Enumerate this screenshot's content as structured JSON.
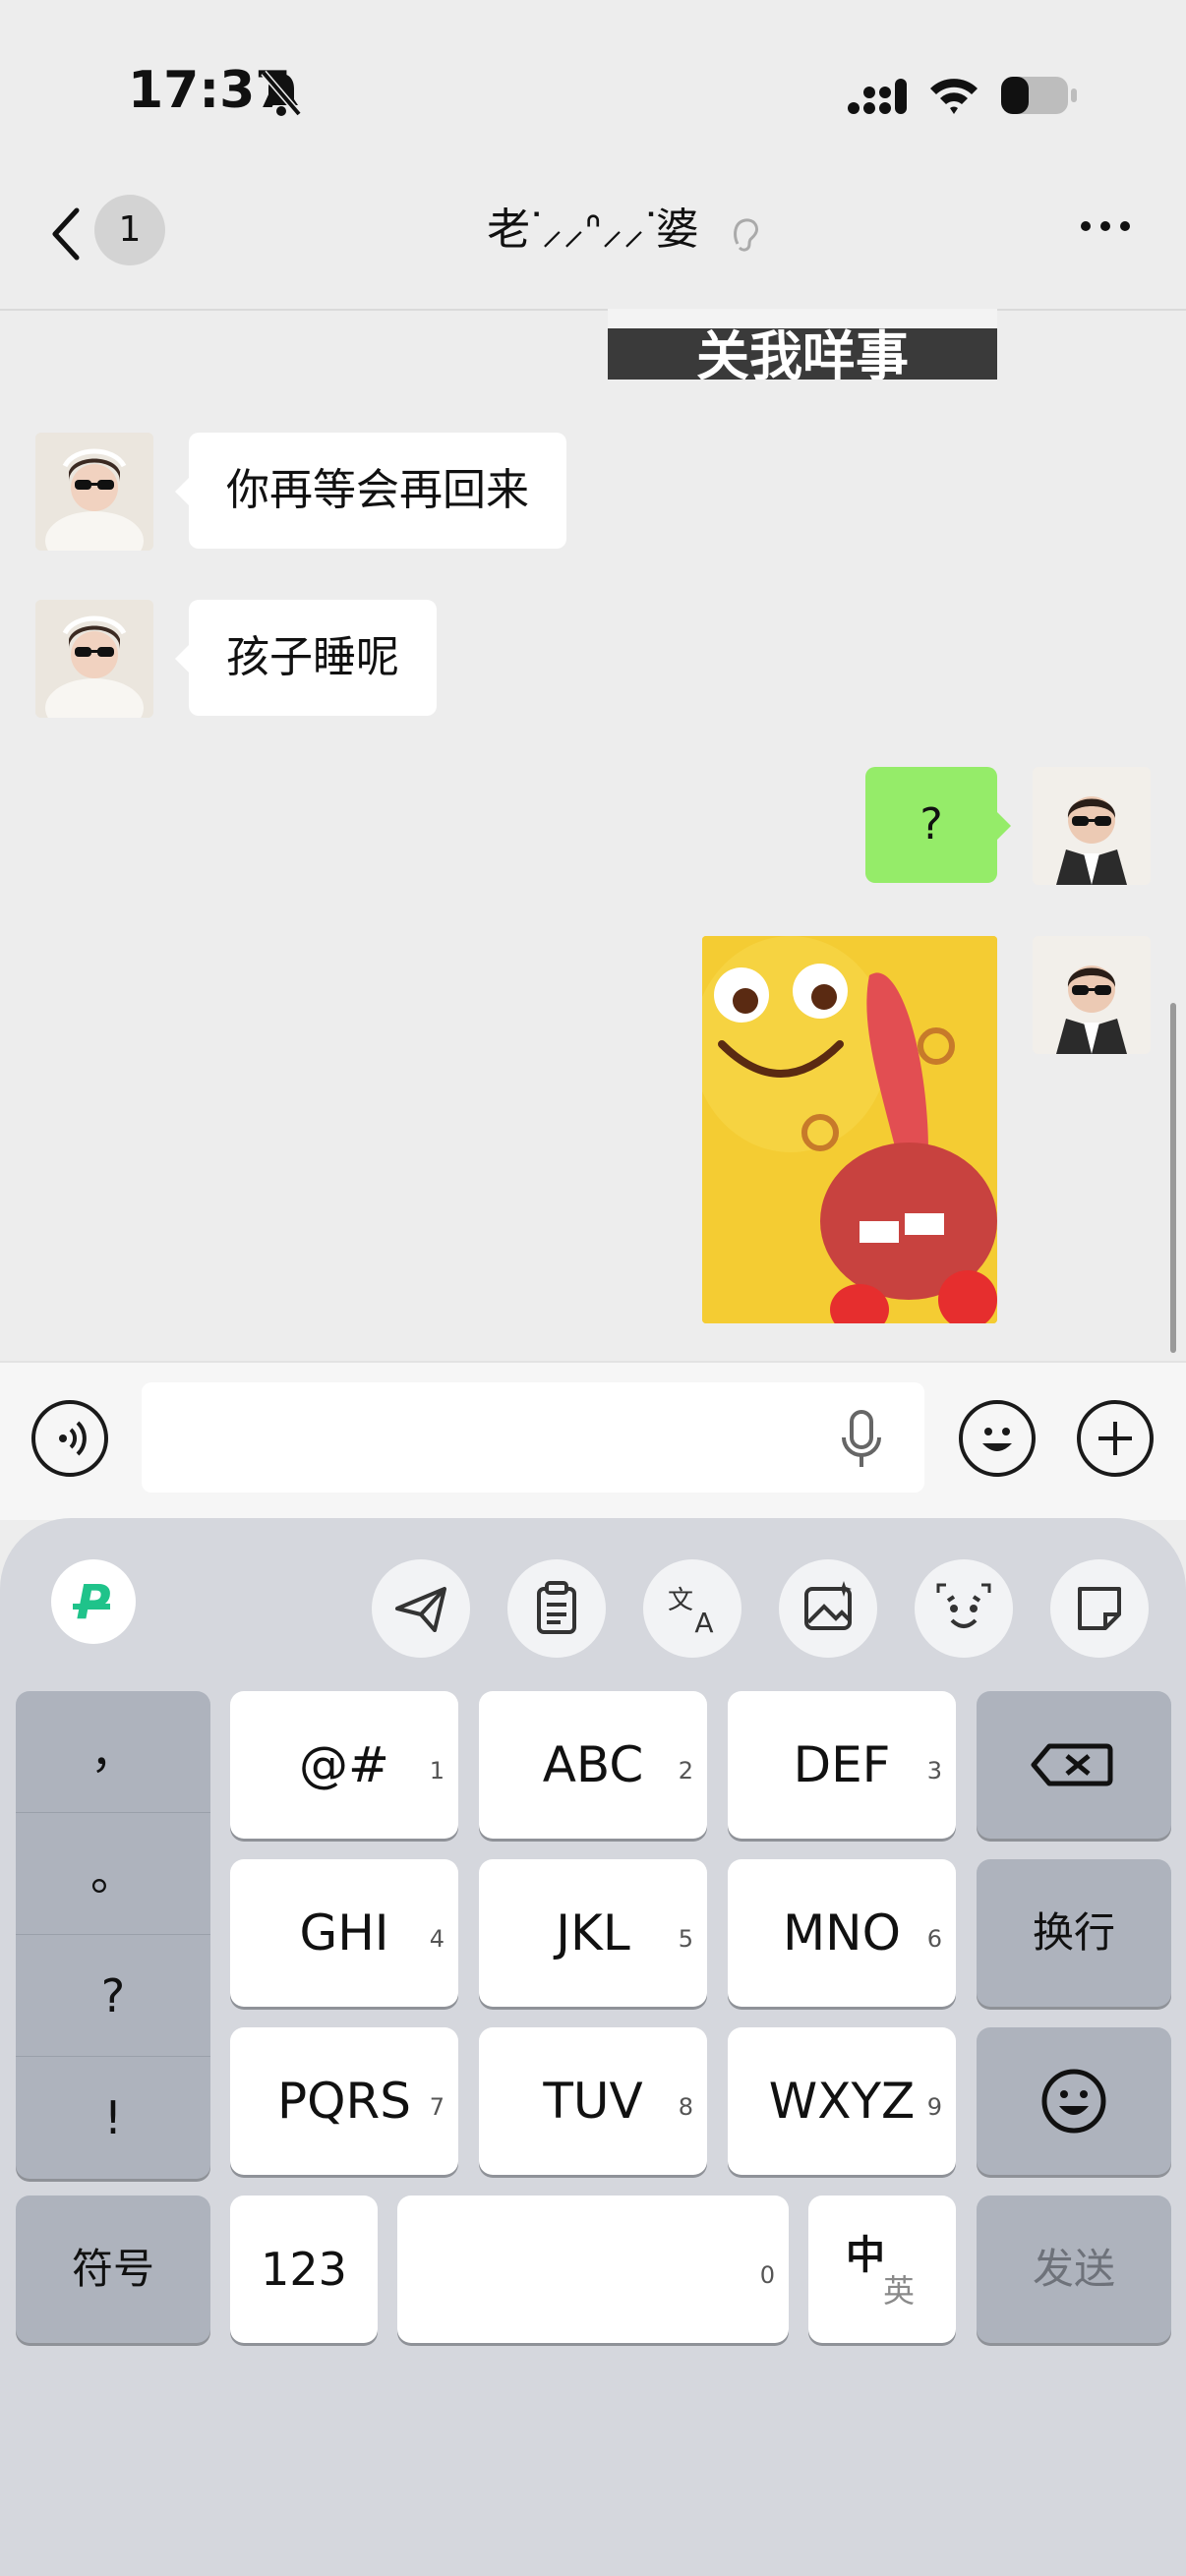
{
  "status_bar": {
    "time": "17:37"
  },
  "nav": {
    "back_badge": "1",
    "title": "老ᐝ⸝⸝ᐢ⸝⸝ᐝ婆"
  },
  "messages": {
    "top_sticker_caption": "关我咩事",
    "incoming": [
      "你再等会再回来",
      "孩子睡呢"
    ],
    "outgoing_text": "?"
  },
  "keyboard": {
    "punctuation": [
      "，",
      "。",
      "?",
      "!"
    ],
    "rows": [
      [
        {
          "label": "@#",
          "num": "1"
        },
        {
          "label": "ABC",
          "num": "2"
        },
        {
          "label": "DEF",
          "num": "3"
        }
      ],
      [
        {
          "label": "GHI",
          "num": "4"
        },
        {
          "label": "JKL",
          "num": "5"
        },
        {
          "label": "MNO",
          "num": "6"
        }
      ],
      [
        {
          "label": "PQRS",
          "num": "7"
        },
        {
          "label": "TUV",
          "num": "8"
        },
        {
          "label": "WXYZ",
          "num": "9"
        }
      ]
    ],
    "newline_label": "换行",
    "symbols_label": "符号",
    "numbers_label": "123",
    "space_num": "0",
    "lang_main": "中",
    "lang_alt": "英",
    "send_label": "发送"
  },
  "colors": {
    "outgoing_bubble": "#95ec69",
    "keyboard_bg": "#d5d7dd",
    "brand_green": "#1fc38a"
  }
}
